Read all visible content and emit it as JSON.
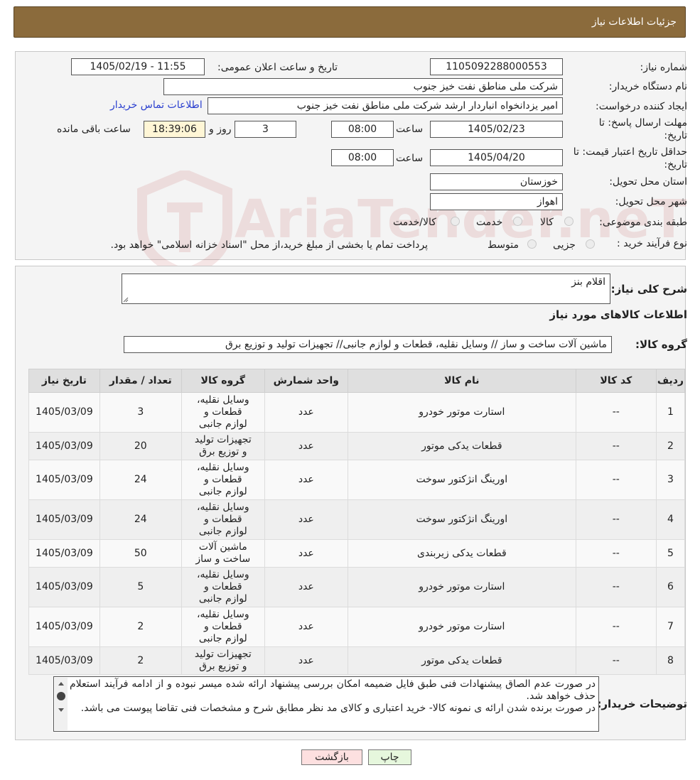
{
  "header": {
    "title": "جزئیات اطلاعات نیاز"
  },
  "form": {
    "need_number_label": "شماره نیاز:",
    "need_number": "1105092288000553",
    "announce_label": "تاریخ و ساعت اعلان عمومی:",
    "announce_value": "1405/02/19 - 11:55",
    "buyer_label": "نام دستگاه خریدار:",
    "buyer_value": "شرکت ملی مناطق نفت خیز جنوب",
    "requester_label": "ایجاد کننده درخواست:",
    "requester_value": "امیر یزدانخواه انباردار ارشد شرکت ملی مناطق نفت خیز جنوب",
    "contact_link": "اطلاعات تماس خریدار",
    "deadline_label_1": "مهلت ارسال پاسخ: تا",
    "deadline_label_2": "تاریخ:",
    "deadline_date": "1405/02/23",
    "time_label": "ساعت",
    "deadline_time": "08:00",
    "days": "3",
    "days_label": "روز و",
    "remaining_time": "18:39:06",
    "remaining_label": "ساعت باقی مانده",
    "validity_label_1": "حداقل تاریخ اعتبار قیمت: تا",
    "validity_label_2": "تاریخ:",
    "validity_date": "1405/04/20",
    "validity_time": "08:00",
    "province_label": "استان محل تحویل:",
    "province_value": "خوزستان",
    "city_label": "شهر محل تحویل:",
    "city_value": "اهواز",
    "category_label": "طبقه بندی موضوعی:",
    "category_options": [
      "کالا",
      "خدمت",
      "کالا/خدمت"
    ],
    "purchase_label": "نوع فرآیند خرید :",
    "purchase_options": [
      "جزیی",
      "متوسط"
    ],
    "purchase_note": "پرداخت تمام یا بخشی از مبلغ خرید،از محل \"اسناد خزانه اسلامی\" خواهد بود."
  },
  "watermark": {
    "text": "AriaTender.neT"
  },
  "summary": {
    "label": "شرح کلی نیاز:",
    "value": "اقلام بنز",
    "goods_info_title": "اطلاعات کالاهای مورد نیاز",
    "group_label": "گروه کالا:",
    "group_value": "ماشین آلات ساخت و ساز // وسایل نقلیه، قطعات و لوازم جانبی// تجهیزات تولید و توزیع برق"
  },
  "table": {
    "headers": [
      "ردیف",
      "کد کالا",
      "نام کالا",
      "واحد شمارش",
      "گروه کالا",
      "تعداد / مقدار",
      "تاریخ نیاز"
    ],
    "rows": [
      [
        "1",
        "--",
        "استارت موتور خودرو",
        "عدد",
        "وسایل نقلیه، قطعات و لوازم جانبی",
        "3",
        "1405/03/09"
      ],
      [
        "2",
        "--",
        "قطعات یدکی موتور",
        "عدد",
        "تجهیزات تولید و توزیع برق",
        "20",
        "1405/03/09"
      ],
      [
        "3",
        "--",
        "اورینگ انژکتور سوخت",
        "عدد",
        "وسایل نقلیه، قطعات و لوازم جانبی",
        "24",
        "1405/03/09"
      ],
      [
        "4",
        "--",
        "اورینگ انژکتور سوخت",
        "عدد",
        "وسایل نقلیه، قطعات و لوازم جانبی",
        "24",
        "1405/03/09"
      ],
      [
        "5",
        "--",
        "قطعات یدکی زیربندی",
        "عدد",
        "ماشین آلات ساخت و ساز",
        "50",
        "1405/03/09"
      ],
      [
        "6",
        "--",
        "استارت موتور خودرو",
        "عدد",
        "وسایل نقلیه، قطعات و لوازم جانبی",
        "5",
        "1405/03/09"
      ],
      [
        "7",
        "--",
        "استارت موتور خودرو",
        "عدد",
        "وسایل نقلیه، قطعات و لوازم جانبی",
        "2",
        "1405/03/09"
      ],
      [
        "8",
        "--",
        "قطعات یدکی موتور",
        "عدد",
        "تجهیزات تولید و توزیع برق",
        "2",
        "1405/03/09"
      ]
    ]
  },
  "notes": {
    "label": "توضیحات خریدار:",
    "line1": "در صورت عدم الصاق پیشنهادات فنی طبق فایل ضمیمه امکان بررسی پیشنهاد ارائه شده میسر نبوده و از ادامه فرآیند استعلام حذف خواهد شد.",
    "line2": "در صورت برنده شدن ارائه ی نمونه کالا- خرید اعتباری و کالای مد نظر مطابق شرح و مشخصات فنی تقاضا پیوست می باشد."
  },
  "buttons": {
    "print": "چاپ",
    "back": "بازگشت"
  }
}
